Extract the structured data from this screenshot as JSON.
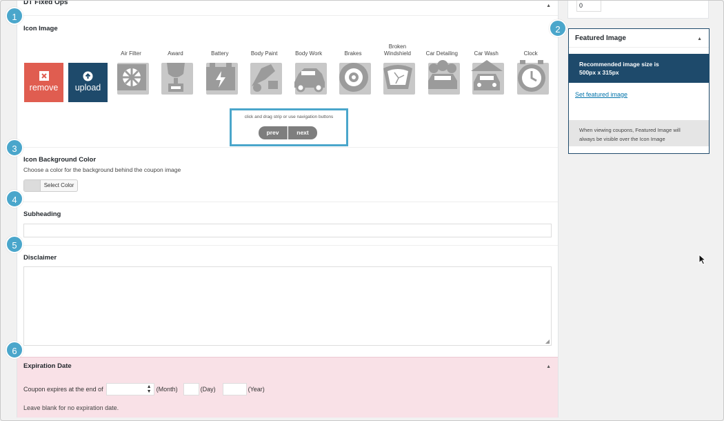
{
  "panel": {
    "title": "DT Fixed Ops",
    "toggle_icon": "▲"
  },
  "callouts": [
    "1",
    "2",
    "3",
    "4",
    "5",
    "6"
  ],
  "icon_image": {
    "label": "Icon Image",
    "remove_label": "remove",
    "upload_label": "upload",
    "icons": [
      {
        "label_lines": [
          "Air Filter"
        ],
        "icon": "air-filter-icon"
      },
      {
        "label_lines": [
          "Award"
        ],
        "icon": "award-icon"
      },
      {
        "label_lines": [
          "Battery"
        ],
        "icon": "battery-icon"
      },
      {
        "label_lines": [
          "Body Paint"
        ],
        "icon": "body-paint-icon"
      },
      {
        "label_lines": [
          "Body Work"
        ],
        "icon": "body-work-icon"
      },
      {
        "label_lines": [
          "Brakes"
        ],
        "icon": "brakes-icon"
      },
      {
        "label_lines": [
          "Broken",
          "Windshield"
        ],
        "icon": "broken-windshield-icon"
      },
      {
        "label_lines": [
          "Car Detailing"
        ],
        "icon": "car-detailing-icon"
      },
      {
        "label_lines": [
          "Car Wash"
        ],
        "icon": "car-wash-icon"
      },
      {
        "label_lines": [
          "Clock"
        ],
        "icon": "clock-icon"
      }
    ],
    "nav_hint": "click and drag strip or use navigation buttons",
    "prev_label": "prev",
    "next_label": "next"
  },
  "background_color": {
    "label": "Icon Background Color",
    "description": "Choose a color for the background behind the coupon image",
    "button_label": "Select Color"
  },
  "subheading": {
    "label": "Subheading",
    "value": ""
  },
  "disclaimer": {
    "label": "Disclaimer",
    "value": ""
  },
  "expiration": {
    "label": "Expiration Date",
    "prefix": "Coupon expires at the end of",
    "month_label": "(Month)",
    "day_label": "(Day)",
    "year_label": "(Year)",
    "month_value": "",
    "day_value": "",
    "year_value": "",
    "note": "Leave blank for no expiration date."
  },
  "sidebar": {
    "order_value": "0",
    "featured": {
      "title": "Featured Image",
      "banner_line1": "Recommended image size is",
      "banner_line2": "500px x 315px",
      "set_link": "Set featured image",
      "note_line1": "When viewing coupons, Featured Image will",
      "note_line2": "always be visible over the Icon Image"
    }
  },
  "colors": {
    "accent": "#4aa6cb",
    "navy": "#1e4a6b",
    "remove_red": "#e05d50",
    "icon_gray": "#9b9b9b",
    "expiration_bg": "#f9e1e7"
  }
}
